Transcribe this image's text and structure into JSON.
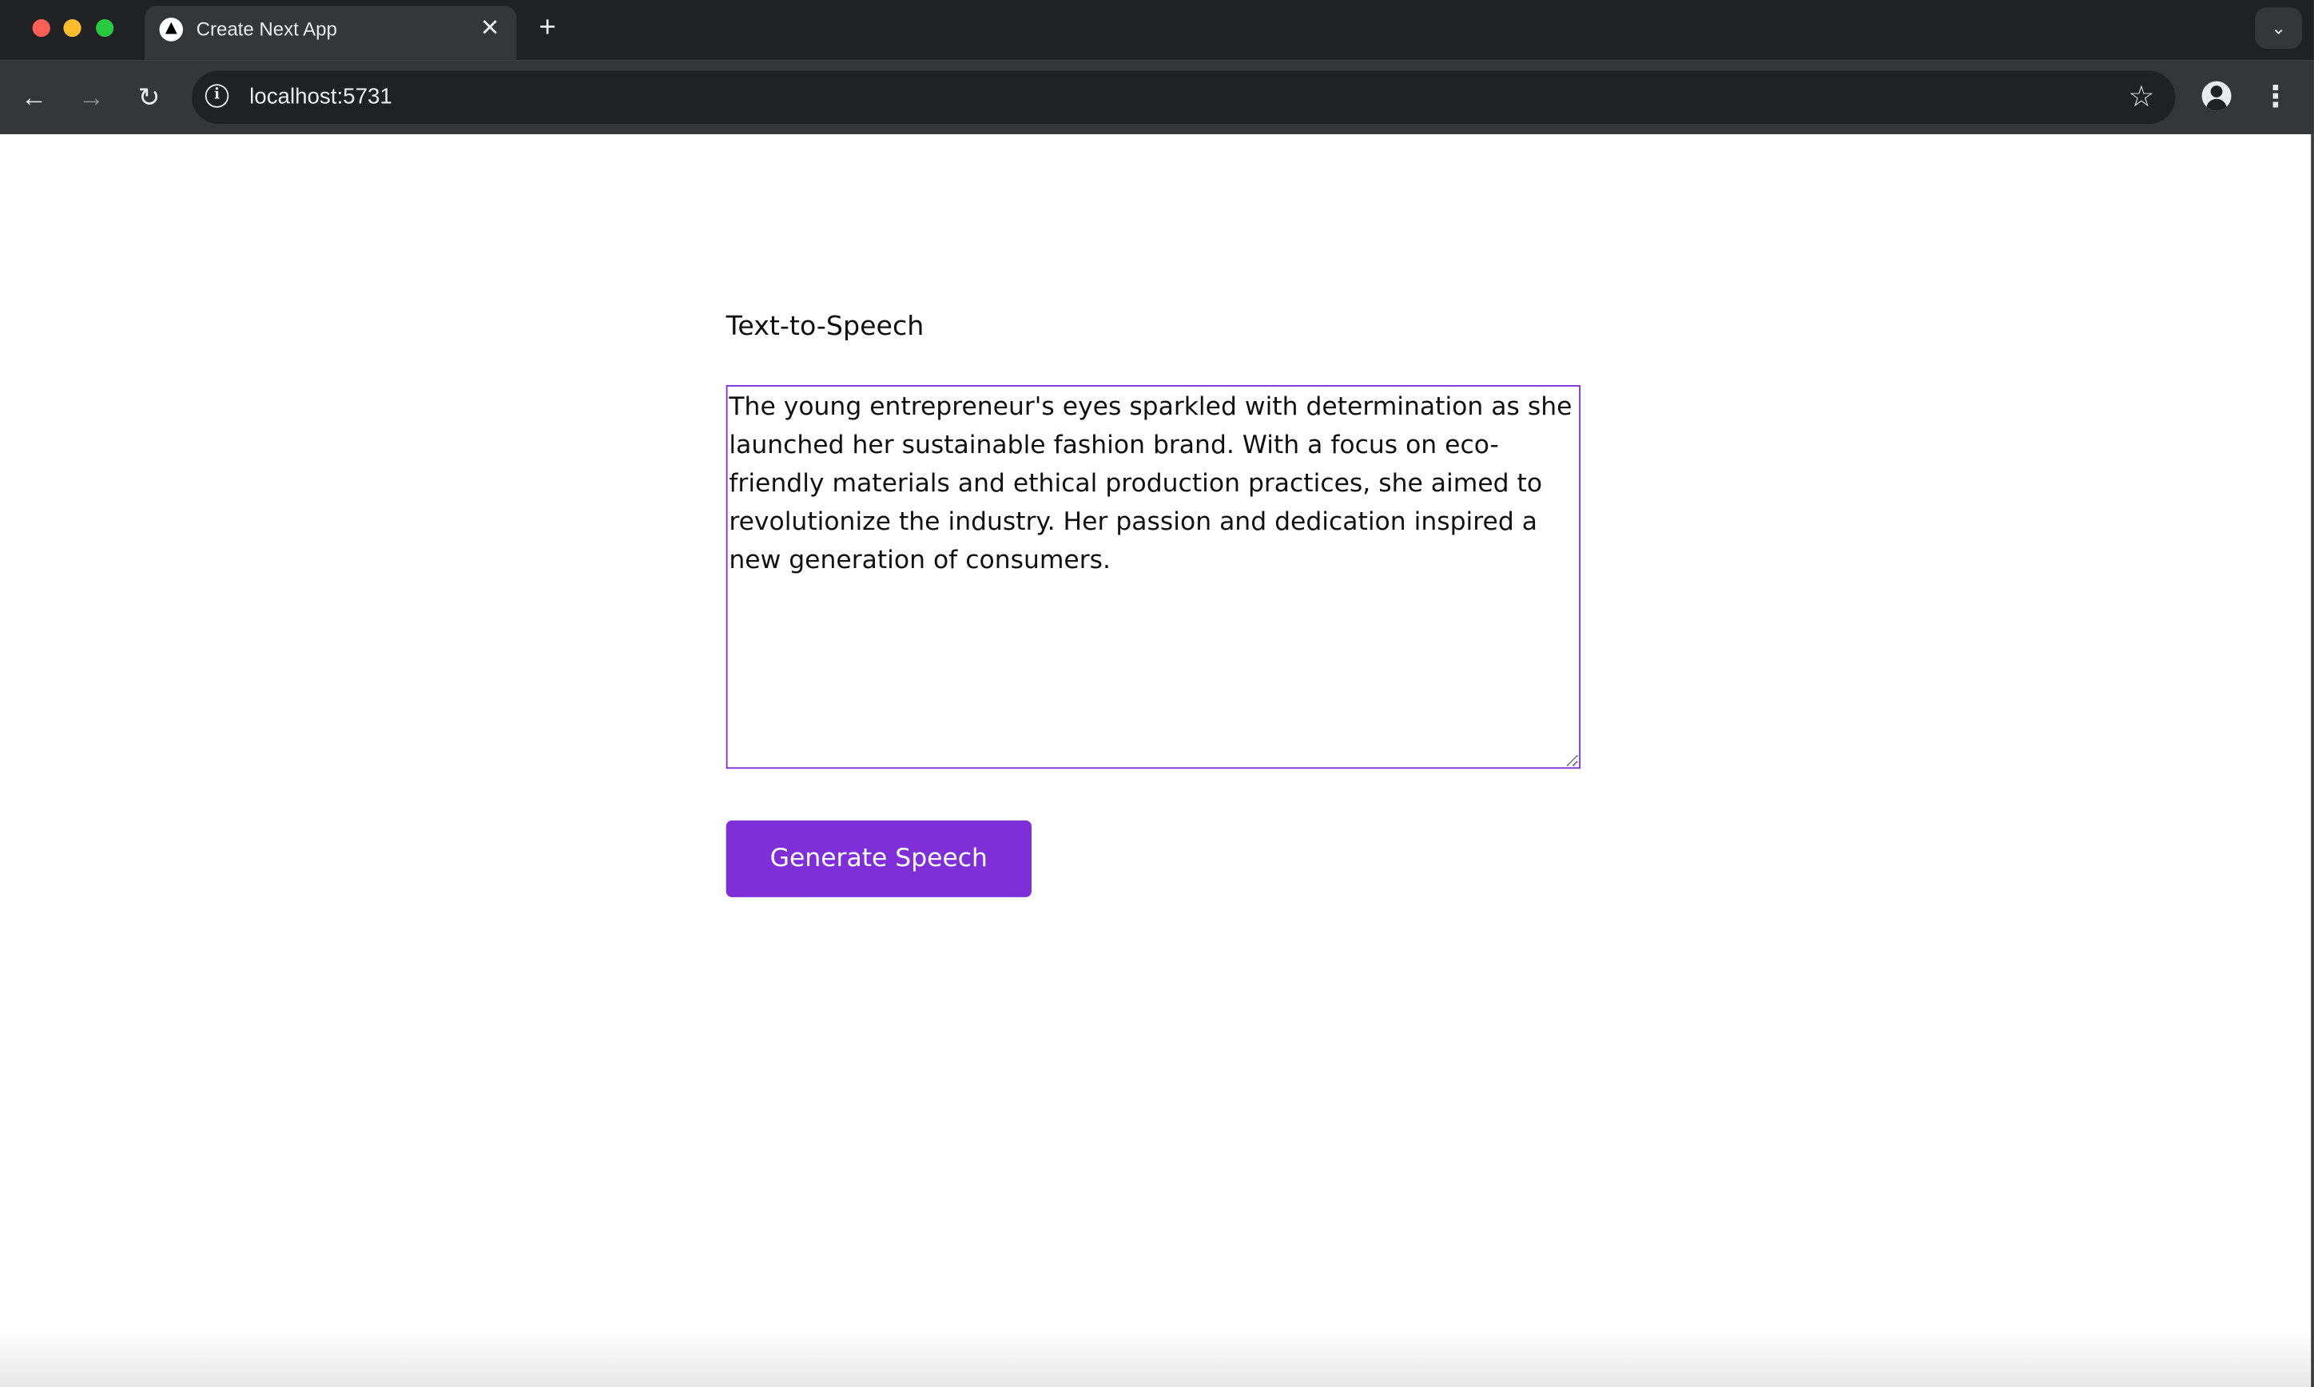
{
  "browser": {
    "tab_title": "Create Next App",
    "tab_close_icon": "close-icon",
    "new_tab_icon": "plus-icon",
    "tab_menu_icon": "chevron-down-icon",
    "back_icon": "arrow-left-icon",
    "forward_icon": "arrow-right-icon",
    "reload_icon": "reload-icon",
    "site_info_icon": "info-icon",
    "url": "localhost:5731",
    "bookmark_icon": "star-icon",
    "profile_icon": "account-icon",
    "menu_icon": "kebab-menu-icon",
    "glyphs": {
      "close": "✕",
      "plus": "+",
      "chevron": "⌄",
      "back": "←",
      "forward": "→",
      "reload": "↻",
      "info": "i",
      "star": "☆",
      "kebab": "⋮"
    }
  },
  "page": {
    "title": "Text-to-Speech",
    "textarea_value": "The young entrepreneur's eyes sparkled with determination as she launched her sustainable fashion brand. With a focus on eco-friendly materials and ethical production practices, she aimed to revolutionize the industry. Her passion and dedication inspired a new generation of consumers.",
    "generate_button_label": "Generate Speech"
  },
  "colors": {
    "accent": "#7e2fd8",
    "chrome_dark": "#202124",
    "chrome_toolbar": "#35363a"
  }
}
